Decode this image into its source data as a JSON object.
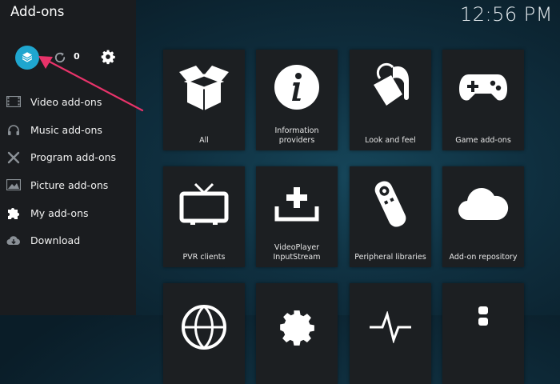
{
  "header": {
    "title": "Add-ons",
    "clock": "12:56 PM"
  },
  "toolbar": {
    "update_count": "0"
  },
  "sidebar": {
    "items": [
      {
        "label": "Video add-ons",
        "icon": "film-icon"
      },
      {
        "label": "Music add-ons",
        "icon": "headphones-icon"
      },
      {
        "label": "Program add-ons",
        "icon": "tools-icon"
      },
      {
        "label": "Picture add-ons",
        "icon": "picture-icon"
      },
      {
        "label": "My add-ons",
        "icon": "puzzle-icon"
      },
      {
        "label": "Download",
        "icon": "cloud-download-icon"
      }
    ]
  },
  "tiles": [
    {
      "label": "All",
      "icon": "open-box-icon"
    },
    {
      "label": "Information providers",
      "icon": "info-icon"
    },
    {
      "label": "Look and feel",
      "icon": "paint-bucket-icon"
    },
    {
      "label": "Game add-ons",
      "icon": "gamepad-icon"
    },
    {
      "label": "PVR clients",
      "icon": "tv-icon"
    },
    {
      "label": "VideoPlayer InputStream",
      "icon": "inputstream-icon"
    },
    {
      "label": "Peripheral libraries",
      "icon": "remote-icon"
    },
    {
      "label": "Add-on repository",
      "icon": "cloud-icon"
    }
  ],
  "colors": {
    "accent": "#1fa6cf",
    "arrow": "#e8336a",
    "sidebar_bg": "#1a1c1f",
    "tile_bg": "#1c1f22"
  }
}
